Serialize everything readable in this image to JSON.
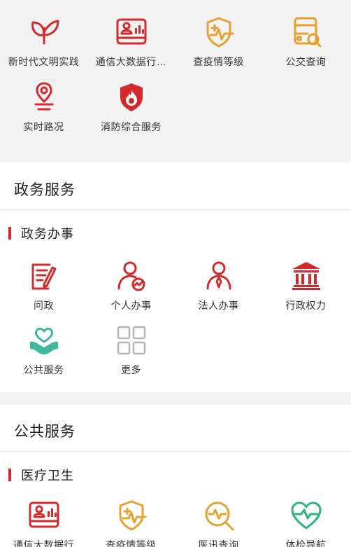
{
  "top_grid": {
    "items": [
      {
        "label": "新时代文明实践",
        "icon": "leaf-icon"
      },
      {
        "label": "通信大数据行…",
        "icon": "id-card-icon"
      },
      {
        "label": "查疫情等级",
        "icon": "shield-pulse-icon"
      },
      {
        "label": "公交查询",
        "icon": "bus-search-icon"
      },
      {
        "label": "实时路况",
        "icon": "location-pin-icon"
      },
      {
        "label": "消防综合服务",
        "icon": "fire-shield-icon"
      }
    ]
  },
  "gov_section": {
    "title": "政务服务",
    "sub_title": "政务办事",
    "items": [
      {
        "label": "问政",
        "icon": "document-edit-icon"
      },
      {
        "label": "个人办事",
        "icon": "person-chart-icon"
      },
      {
        "label": "法人办事",
        "icon": "legal-person-icon"
      },
      {
        "label": "行政权力",
        "icon": "government-building-icon"
      },
      {
        "label": "公共服务",
        "icon": "heart-hands-icon"
      },
      {
        "label": "更多",
        "icon": "grid-more-icon"
      }
    ]
  },
  "public_section": {
    "title": "公共服务",
    "sub_title": "医疗卫生",
    "items": [
      {
        "label": "通信大数据行",
        "icon": "id-card-icon"
      },
      {
        "label": "查疫情等级",
        "icon": "shield-pulse-icon"
      },
      {
        "label": "医讯查询",
        "icon": "magnifier-pulse-icon"
      },
      {
        "label": "体检导航",
        "icon": "heart-pulse-icon"
      }
    ]
  },
  "colors": {
    "red": "#d5282c",
    "orange": "#e6a030",
    "teal": "#3fb8a0",
    "green": "#2fb37c",
    "gray": "#b5b5b5",
    "bg_gray": "#f3f3f3",
    "accent_bar": "#d5282c"
  }
}
